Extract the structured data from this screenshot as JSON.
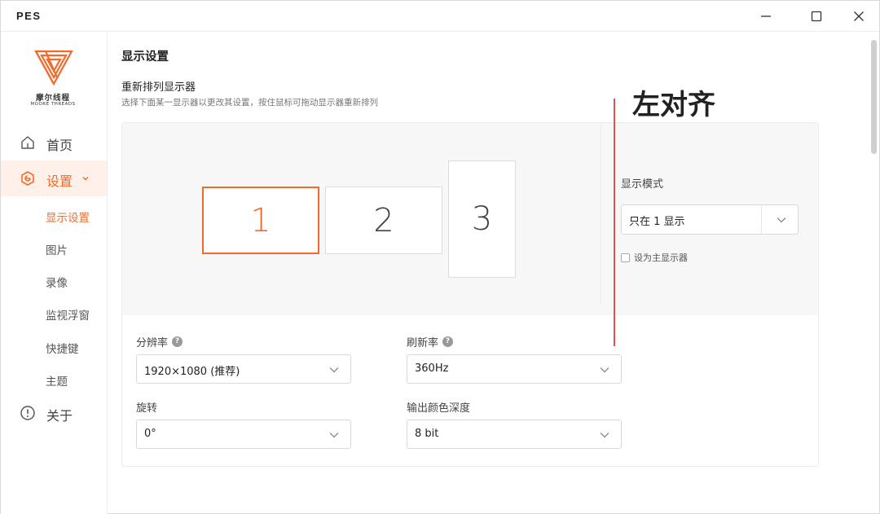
{
  "app": {
    "title": "PES",
    "logo_cn": "摩尔线程",
    "logo_en": "MOORE THREADS",
    "accent_color": "#f26b2a"
  },
  "window_controls": {
    "minimize_icon": "minimize-icon",
    "maximize_icon": "maximize-icon",
    "close_icon": "close-icon"
  },
  "sidebar": {
    "items": [
      {
        "label": "首页",
        "icon": "home-icon"
      },
      {
        "label": "设置",
        "icon": "settings-icon",
        "active": true,
        "expanded": true
      },
      {
        "label": "关于",
        "icon": "info-icon"
      }
    ],
    "sub_items": [
      {
        "label": "显示设置",
        "active": true
      },
      {
        "label": "图片"
      },
      {
        "label": "录像"
      },
      {
        "label": "监视浮窗"
      },
      {
        "label": "快捷键"
      },
      {
        "label": "主题"
      }
    ]
  },
  "main": {
    "page_title": "显示设置",
    "section_title": "重新排列显示器",
    "section_desc": "选择下面某一显示器以更改其设置，按住鼠标可拖动显示器重新排列",
    "monitors": [
      {
        "label": "1",
        "selected": true
      },
      {
        "label": "2"
      },
      {
        "label": "3"
      }
    ],
    "display_mode": {
      "label": "显示模式",
      "value": "只在 1 显示"
    },
    "primary_checkbox": {
      "label": "设为主显示器",
      "checked": false
    },
    "resolution": {
      "label": "分辨率",
      "value": "1920×1080 (推荐)",
      "help": "?"
    },
    "refresh_rate": {
      "label": "刷新率",
      "value": "360Hz",
      "help": "?"
    },
    "rotation": {
      "label": "旋转",
      "value": "0°"
    },
    "color_depth": {
      "label": "输出颜色深度",
      "value": "8 bit"
    }
  },
  "annotation": {
    "text": "左对齐",
    "line_color": "#e05050"
  }
}
